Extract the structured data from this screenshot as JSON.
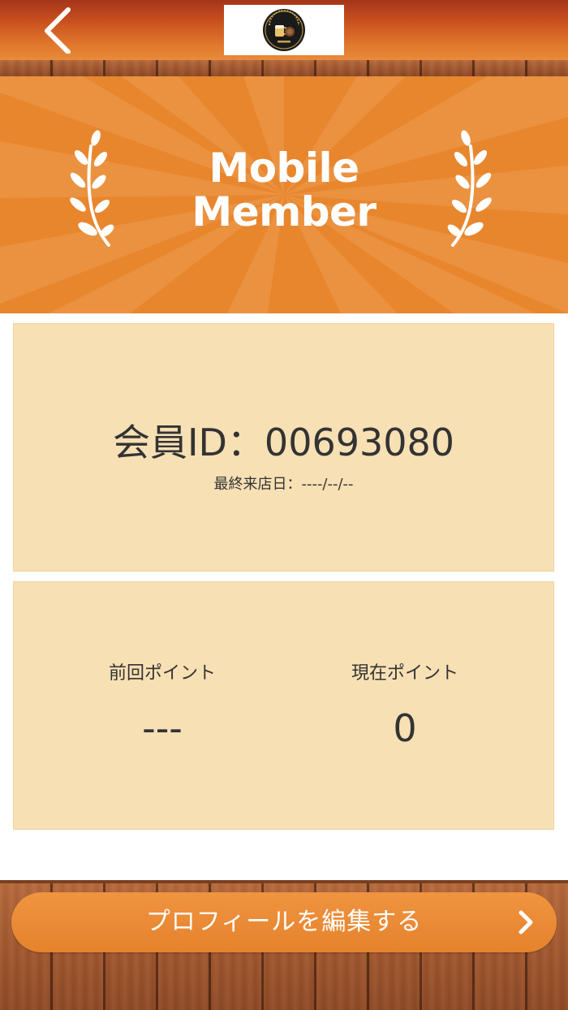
{
  "header": {
    "back_icon": "chevron-left-icon",
    "logo_icon": "bar-logo"
  },
  "banner": {
    "title_line1": "Mobile",
    "title_line2": "Member",
    "left_icon": "laurel-left-icon",
    "right_icon": "laurel-right-icon"
  },
  "member": {
    "id_text": "会員ID：00693080",
    "last_visit_text": "最終来店日：----/--/--"
  },
  "points": {
    "previous_label": "前回ポイント",
    "previous_value": "---",
    "current_label": "現在ポイント",
    "current_value": "0"
  },
  "footer": {
    "edit_profile_label": "プロフィールを編集する",
    "edit_profile_icon": "chevron-right-icon"
  },
  "colors": {
    "banner_orange": "#e8862e",
    "card_beige": "#f7e0b4",
    "button_orange": "#e6822c",
    "header_dark": "#a5351a"
  }
}
